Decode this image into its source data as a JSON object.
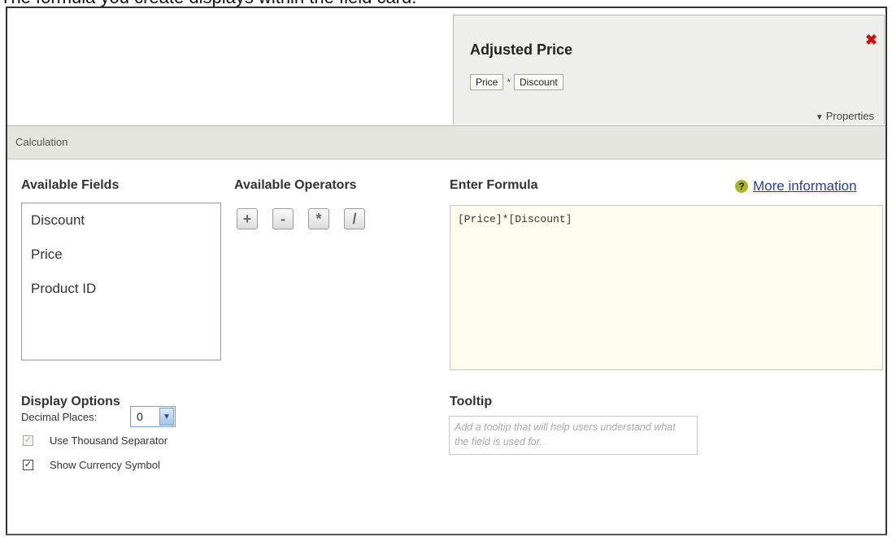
{
  "caption": "The formula you create displays within the field card.",
  "field_card": {
    "title": "Adjusted Price",
    "tokens": [
      "Price",
      "Discount"
    ],
    "operator": "*",
    "properties_label": "Properties"
  },
  "panel": {
    "header": "Calculation",
    "available_fields": {
      "label": "Available Fields",
      "items": [
        "Discount",
        "Price",
        "Product ID"
      ]
    },
    "available_operators": {
      "label": "Available Operators",
      "items": [
        "+",
        "-",
        "*",
        "/"
      ]
    },
    "formula": {
      "label": "Enter Formula",
      "value": "[Price]*[Discount]",
      "help_link": "More information"
    },
    "display_options": {
      "label": "Display Options",
      "decimal_label": "Decimal Places:",
      "decimal_value": "0",
      "use_thousand_separator": "Use Thousand Separator",
      "show_currency_symbol": "Show Currency Symbol"
    },
    "tooltip": {
      "label": "Tooltip",
      "placeholder": "Add a tooltip that will help users understand what the field is used for."
    }
  },
  "icons": {
    "close": "close-icon",
    "properties": "triangle-down-icon",
    "help": "help-icon",
    "select": "chevron-down-icon",
    "check": "checkmark-icon"
  },
  "colors": {
    "close": "#cc1111",
    "help_icon": "#a6b82a",
    "link": "#2a3f8f",
    "formula_bg": "#fefdf0",
    "card_bg": "#eeeeea",
    "header_bg": "#e6e6e0"
  }
}
